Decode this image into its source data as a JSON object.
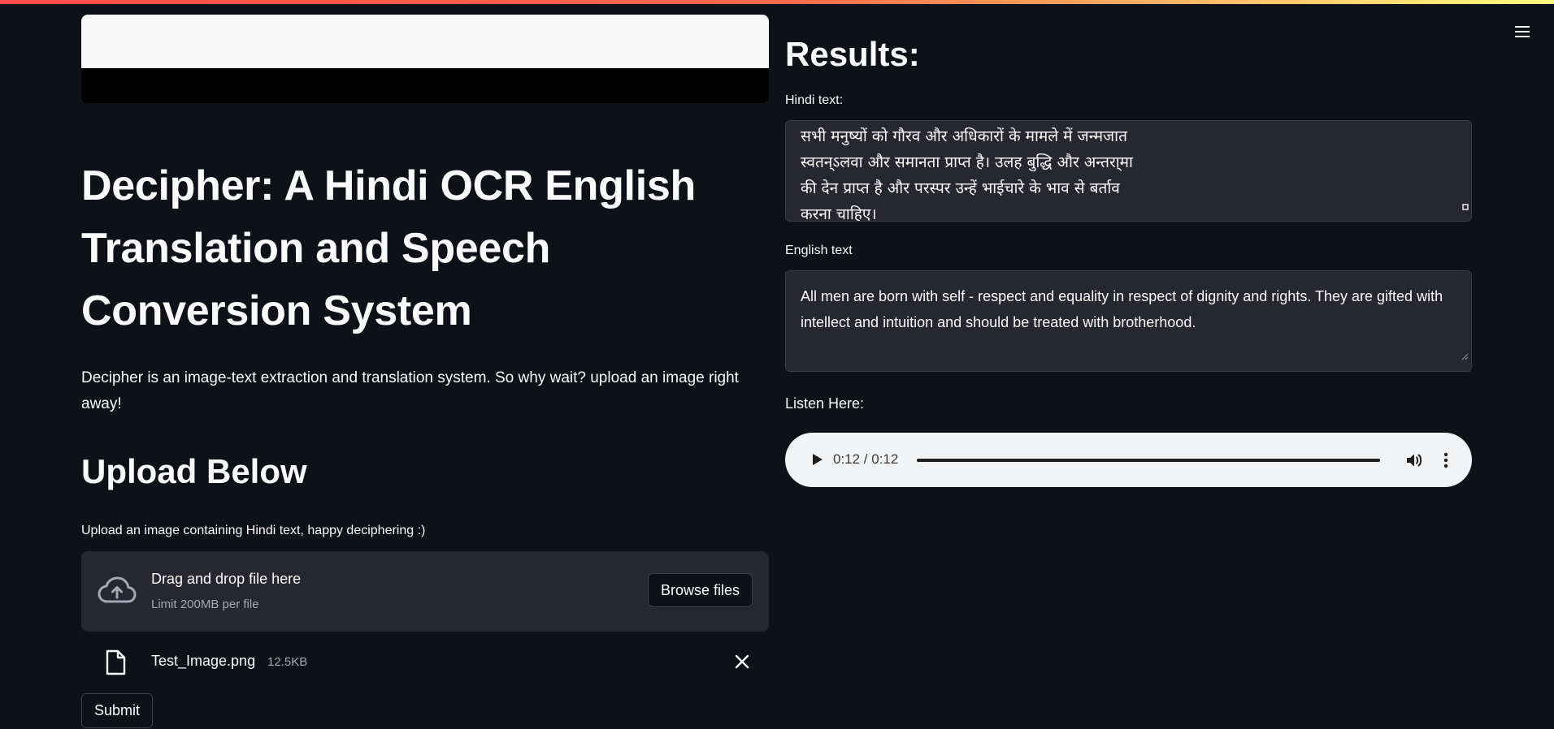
{
  "colors": {
    "background": "#0e1117",
    "panel": "#262730",
    "text": "#fafafa",
    "muted": "#a3a8b8",
    "accent": "#ff4b4b"
  },
  "header": {
    "menu_icon": "hamburger-menu-icon"
  },
  "left": {
    "title": "Decipher: A Hindi OCR English Translation and Speech Conversion System",
    "description": "Decipher is an image-text extraction and translation system. So why wait? upload an image right away!",
    "upload_heading": "Upload Below",
    "uploader": {
      "label": "Upload an image containing Hindi text, happy deciphering :)",
      "drop_title": "Drag and drop file here",
      "drop_limit": "Limit 200MB per file",
      "browse_label": "Browse files",
      "icon": "cloud-upload-icon"
    },
    "file": {
      "name": "Test_Image.png",
      "size": "12.5KB",
      "icon": "file-icon"
    },
    "submit_label": "Submit"
  },
  "right": {
    "heading": "Results:",
    "hindi_label": "Hindi text:",
    "hindi_text": "सभी मनुष्यों को गौरव और अधिकारों के मामले में जन्मजात\nस्वतन्ऽलवा और समानता प्राप्त है। उलह बुद्धि और अन्तरा्मा\nकी देन प्राप्त है और परस्पर उन्हें भाईचारे के भाव से बर्ताव\nकरना चाहिए।",
    "english_label": "English text",
    "english_text": "All men are born with self - respect and equality in respect of dignity and rights. They are gifted with intellect and intuition and should be treated with brotherhood.",
    "listen_label": "Listen Here:",
    "audio": {
      "time": "0:12 / 0:12",
      "progress": 1.0
    }
  }
}
